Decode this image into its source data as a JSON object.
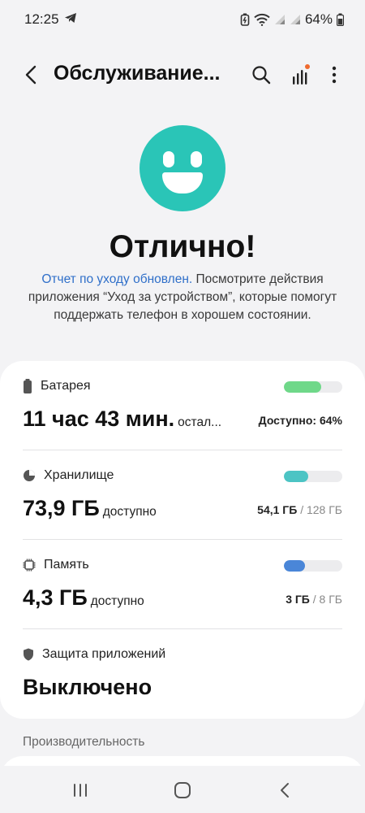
{
  "status_bar": {
    "time": "12:25",
    "battery": "64%",
    "icons": [
      "telegram-icon",
      "battery-saver-icon",
      "wifi-icon",
      "signal-icon",
      "signal-icon",
      "battery-icon"
    ]
  },
  "app_bar": {
    "title": "Обслуживание...",
    "icons": [
      "back-icon",
      "search-icon",
      "stats-icon",
      "more-icon"
    ],
    "notification_dot_color": "#ef6a2e"
  },
  "hero": {
    "headline": "Отлично!",
    "link_text": "Отчет по уходу обновлен.",
    "description": " Посмотрите действия приложения “Уход за устройством”, которые помогут поддержать телефон в хорошем состоянии.",
    "smiley_color": "#2ac5b7"
  },
  "sections": {
    "battery": {
      "label": "Батарея",
      "value": "11 час 43 мин.",
      "unit": "остал...",
      "note": "Доступно: 64%",
      "level": 0.64,
      "color": "#6fd889"
    },
    "storage": {
      "label": "Хранилище",
      "value": "73,9 ГБ",
      "unit": "доступно",
      "used": "54,1 ГБ",
      "total": "/ 128 ГБ",
      "level": 0.42,
      "color": "#4cc4c4"
    },
    "memory": {
      "label": "Память",
      "value": "4,3 ГБ",
      "unit": "доступно",
      "used": "3 ГБ",
      "total": "/ 8 ГБ",
      "level": 0.36,
      "color": "#4a86d8"
    },
    "protection": {
      "label": "Защита приложений",
      "value": "Выключено"
    }
  },
  "performance_label": "Производительность",
  "nav_bar": {
    "icons": [
      "recent-apps-icon",
      "home-icon",
      "back-nav-icon"
    ]
  }
}
